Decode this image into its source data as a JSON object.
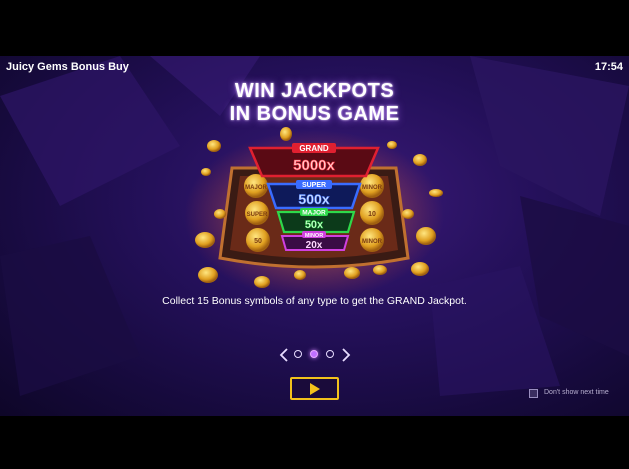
{
  "header": {
    "game_title": "Juicy Gems Bonus Buy",
    "clock": "17:54"
  },
  "slide": {
    "headline_line1": "WIN JACKPOTS",
    "headline_line2": "IN BONUS GAME",
    "description": "Collect 15 Bonus symbols of any type to get the GRAND Jackpot."
  },
  "jackpots": [
    {
      "name": "GRAND",
      "multiplier": "5000x",
      "color": "#e02030"
    },
    {
      "name": "SUPER",
      "multiplier": "500x",
      "color": "#3a6cff"
    },
    {
      "name": "MAJOR",
      "multiplier": "50x",
      "color": "#2ed84a"
    },
    {
      "name": "MINOR",
      "multiplier": "20x",
      "color": "#d040e0"
    }
  ],
  "coin_labels": {
    "left_top": "MAJOR",
    "left_mid": "SUPER",
    "left_bottom": "50",
    "right_top": "MINOR",
    "right_mid": "10",
    "right_bottom": "MINOR"
  },
  "pager": {
    "page_count": 3,
    "current_page": 2
  },
  "controls": {
    "dont_show_label": "Don't show next time",
    "dont_show_checked": false,
    "play_icon": "play-icon",
    "prev_icon": "chevron-left-icon",
    "next_icon": "chevron-right-icon"
  },
  "colors": {
    "accent_gold": "#f2c21b",
    "background": "#1e0e4a"
  }
}
